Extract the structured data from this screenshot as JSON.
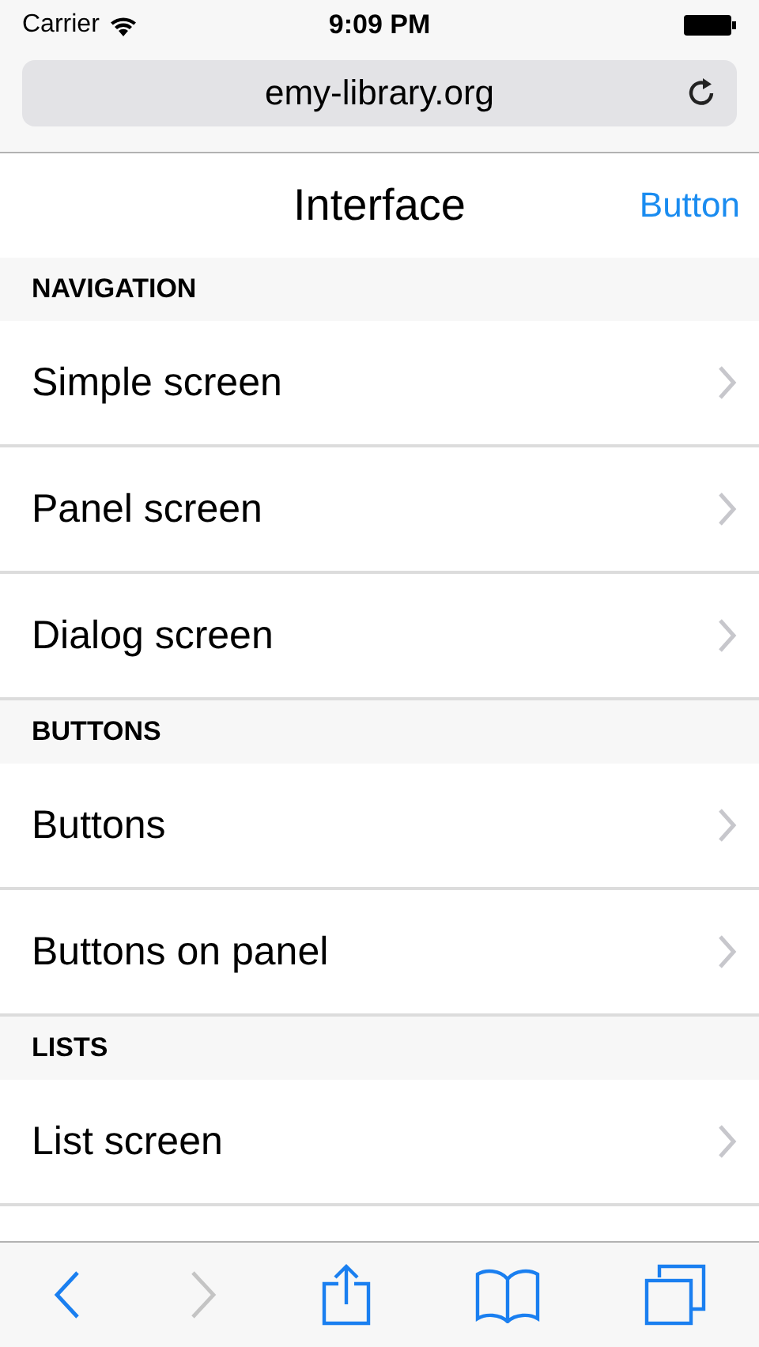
{
  "status_bar": {
    "carrier": "Carrier",
    "time": "9:09 PM"
  },
  "address_bar": {
    "url": "emy-library.org"
  },
  "nav_bar": {
    "title": "Interface",
    "button": "Button"
  },
  "sections": [
    {
      "header": "NAVIGATION",
      "items": [
        {
          "label": "Simple screen"
        },
        {
          "label": "Panel screen"
        },
        {
          "label": "Dialog screen"
        }
      ]
    },
    {
      "header": "BUTTONS",
      "items": [
        {
          "label": "Buttons"
        },
        {
          "label": "Buttons on panel"
        }
      ]
    },
    {
      "header": "LISTS",
      "items": [
        {
          "label": "List screen"
        }
      ]
    }
  ],
  "toolbar": {
    "back": {
      "disabled": false
    },
    "forward": {
      "disabled": true
    }
  }
}
